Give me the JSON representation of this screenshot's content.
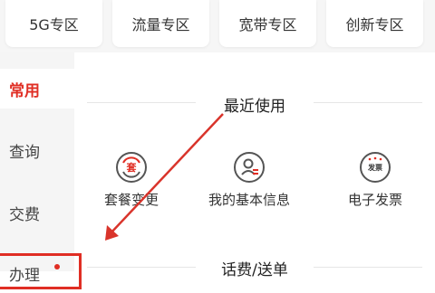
{
  "top_zones": [
    {
      "label": "5G专区"
    },
    {
      "label": "流量专区"
    },
    {
      "label": "宽带专区"
    },
    {
      "label": "创新专区"
    }
  ],
  "sidebar": {
    "items": [
      {
        "label": "常用",
        "active": true
      },
      {
        "label": "查询",
        "active": false
      },
      {
        "label": "交费",
        "active": false
      },
      {
        "label": "办理",
        "active": false,
        "has_dot": true
      }
    ]
  },
  "sections": {
    "recent_title": "最近使用",
    "next_title": "话费/送单"
  },
  "recent_items": [
    {
      "label": "套餐变更",
      "icon_text": "套",
      "icon": "package-change-icon"
    },
    {
      "label": "我的基本信息",
      "icon_text": "",
      "icon": "user-profile-icon"
    },
    {
      "label": "电子发票",
      "icon_text": "发票",
      "icon": "invoice-icon"
    }
  ],
  "colors": {
    "accent": "#e02e24",
    "annotation": "#d9342b"
  }
}
